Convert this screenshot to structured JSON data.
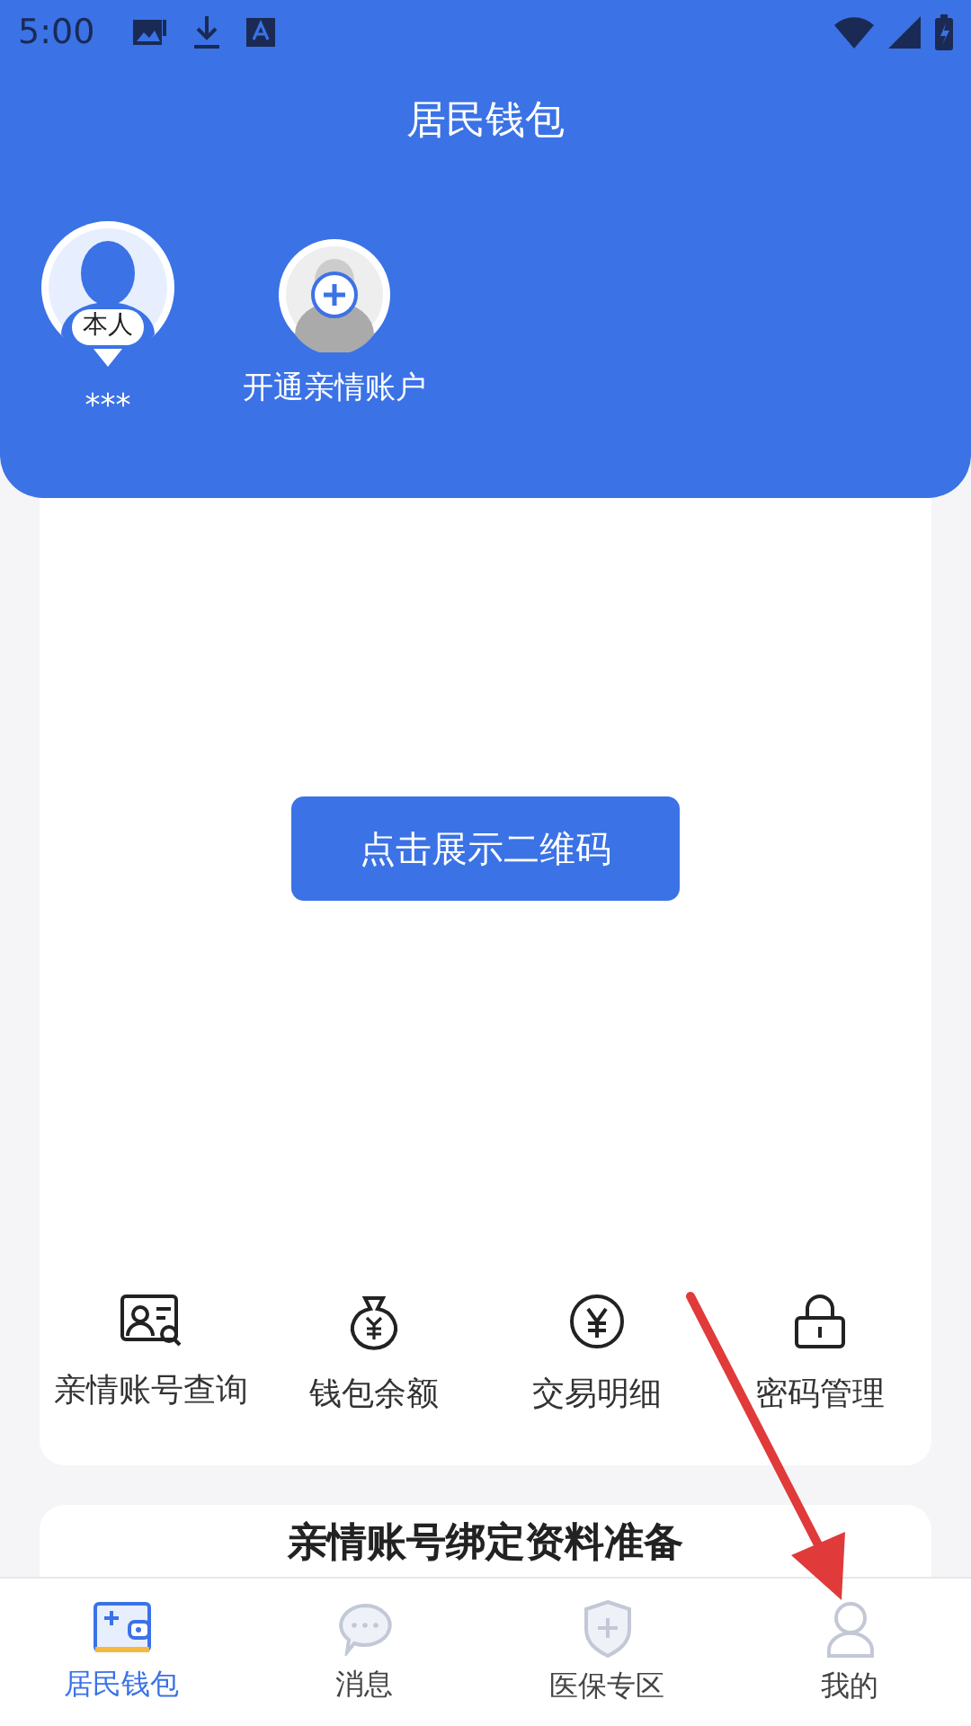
{
  "status_bar": {
    "time": "5:00"
  },
  "header": {
    "title": "居民钱包"
  },
  "accounts": [
    {
      "kind": "self",
      "badge": "本人",
      "name": "***",
      "selected": true
    },
    {
      "kind": "add",
      "name": "开通亲情账户",
      "selected": false
    }
  ],
  "qr_card": {
    "button": "点击展示二维码"
  },
  "functions": [
    {
      "kind": "id-card",
      "label": "亲情账号查询"
    },
    {
      "kind": "money-bag",
      "label": "钱包余额"
    },
    {
      "kind": "yuan",
      "label": "交易明细"
    },
    {
      "kind": "lock",
      "label": "密码管理"
    }
  ],
  "info_card": {
    "title": "亲情账号绑定资料准备"
  },
  "bottom_nav": [
    {
      "kind": "wallet",
      "label": "居民钱包",
      "selected": true
    },
    {
      "kind": "chat",
      "label": "消息",
      "selected": false
    },
    {
      "kind": "shield",
      "label": "医保专区",
      "selected": false
    },
    {
      "kind": "person",
      "label": "我的",
      "selected": false
    }
  ]
}
